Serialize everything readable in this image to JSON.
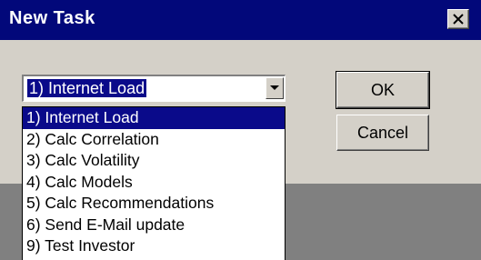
{
  "window": {
    "title": "New Task",
    "close_icon": "close-icon"
  },
  "task_select": {
    "selected_value": "1) Internet Load",
    "arrow_icon": "chevron-down-icon",
    "options": [
      "1) Internet Load",
      "2) Calc Correlation",
      "3) Calc Volatility",
      "4) Calc Models",
      "5) Calc Recommendations",
      "6) Send E-Mail update",
      "9) Test Investor"
    ],
    "highlighted_index": 0
  },
  "buttons": {
    "ok_label": "OK",
    "cancel_label": "Cancel"
  },
  "colors": {
    "titlebar": "#02087a",
    "selection": "#0a0a8a",
    "face": "#d4d0c8",
    "panel": "#808080"
  }
}
